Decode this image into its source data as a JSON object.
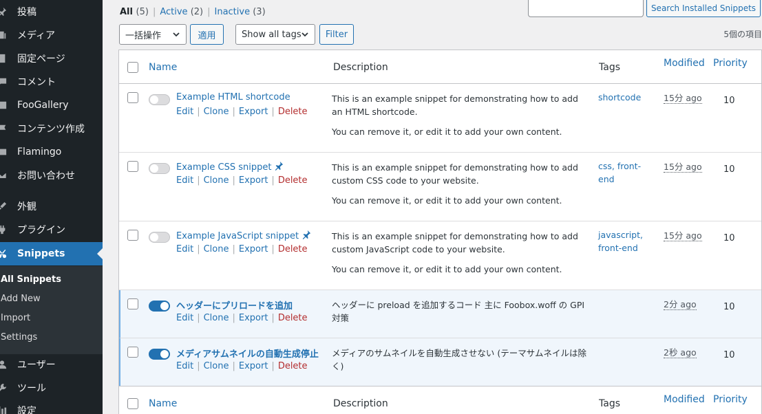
{
  "sidebar": {
    "items": [
      {
        "label": "投稿",
        "icon": "pin-icon"
      },
      {
        "label": "メディア",
        "icon": "media-icon"
      },
      {
        "label": "固定ページ",
        "icon": "page-icon"
      },
      {
        "label": "コメント",
        "icon": "comment-icon"
      },
      {
        "label": "FooGallery",
        "icon": "gallery-icon"
      },
      {
        "label": "コンテンツ作成",
        "icon": "flag-icon"
      },
      {
        "label": "Flamingo",
        "icon": "flamingo-icon"
      },
      {
        "label": "お問い合わせ",
        "icon": "mail-icon"
      },
      {
        "label": "外観",
        "icon": "appearance-icon"
      },
      {
        "label": "プラグイン",
        "icon": "plugin-icon"
      },
      {
        "label": "Snippets",
        "icon": "scissors-icon"
      },
      {
        "label": "ユーザー",
        "icon": "users-icon"
      },
      {
        "label": "ツール",
        "icon": "tools-icon"
      },
      {
        "label": "設定",
        "icon": "settings-icon"
      }
    ],
    "submenu": [
      "All Snippets",
      "Add New",
      "Import",
      "Settings"
    ]
  },
  "filters": {
    "all_label": "All",
    "all_count": "(5)",
    "active_label": "Active",
    "active_count": "(2)",
    "inactive_label": "Inactive",
    "inactive_count": "(3)"
  },
  "search": {
    "button_label": "Search Installed Snippets",
    "value": ""
  },
  "toolbar": {
    "bulk_action": "一括操作",
    "apply_label": "適用",
    "tag_filter": "Show all tags",
    "filter_label": "Filter",
    "item_count": "5個の項目"
  },
  "table": {
    "columns": {
      "name": "Name",
      "description": "Description",
      "tags": "Tags",
      "modified": "Modified",
      "priority": "Priority"
    },
    "actions": {
      "edit": "Edit",
      "clone": "Clone",
      "export": "Export",
      "delete": "Delete"
    },
    "rows": [
      {
        "name": "Example HTML shortcode",
        "active": false,
        "desc1": "This is an example snippet for demonstrating how to add an HTML shortcode.",
        "desc2": "You can remove it, or edit it to add your own content.",
        "tags": "shortcode",
        "modified": "15分 ago",
        "priority": "10"
      },
      {
        "name": "Example CSS snippet",
        "active": false,
        "desc1": "This is an example snippet for demonstrating how to add custom CSS code to your website.",
        "desc2": "You can remove it, or edit it to add your own content.",
        "tags": "css, front-end",
        "modified": "15分 ago",
        "priority": "10"
      },
      {
        "name": "Example JavaScript snippet",
        "active": false,
        "desc1": "This is an example snippet for demonstrating how to add custom JavaScript code to your website.",
        "desc2": "You can remove it, or edit it to add your own content.",
        "tags": "javascript, front-end",
        "modified": "15分 ago",
        "priority": "10"
      },
      {
        "name": "ヘッダーにプリロードを追加",
        "active": true,
        "desc1": "ヘッダーに preload を追加するコード 主に Foobox.woff の GPI 対策",
        "desc2": "",
        "tags": "",
        "modified": "2分 ago",
        "priority": "10"
      },
      {
        "name": "メディアサムネイルの自動生成停止",
        "active": true,
        "desc1": "メディアのサムネイルを自動生成させない (テーマサムネイルは除く)",
        "desc2": "",
        "tags": "",
        "modified": "2秒 ago",
        "priority": "10"
      }
    ]
  }
}
